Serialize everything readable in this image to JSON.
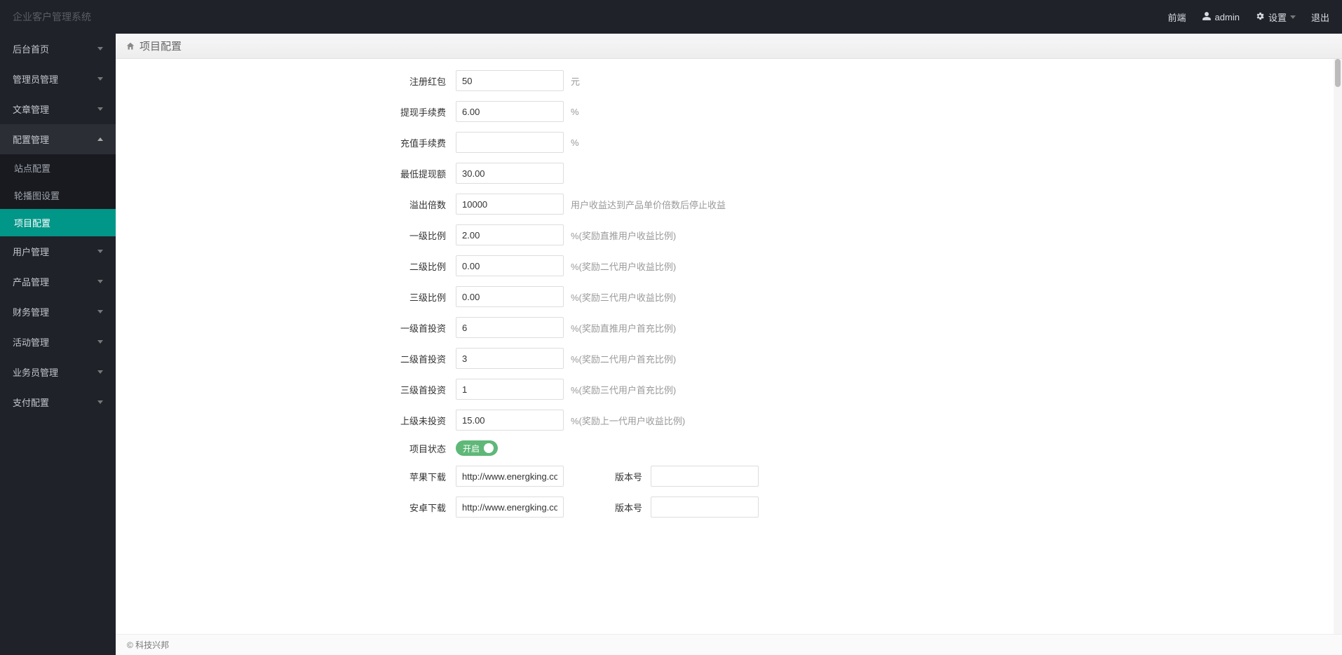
{
  "brand": "企业客户管理系统",
  "header": {
    "frontend": "前端",
    "user": "admin",
    "settings": "设置",
    "logout": "退出"
  },
  "sidebar": {
    "items": [
      {
        "label": "后台首页",
        "expandable": true
      },
      {
        "label": "管理员管理",
        "expandable": true
      },
      {
        "label": "文章管理",
        "expandable": true
      },
      {
        "label": "配置管理",
        "expandable": true,
        "open": true,
        "sub": [
          {
            "label": "站点配置"
          },
          {
            "label": "轮播图设置"
          },
          {
            "label": "项目配置",
            "active": true
          }
        ]
      },
      {
        "label": "用户管理",
        "expandable": true
      },
      {
        "label": "产品管理",
        "expandable": true
      },
      {
        "label": "财务管理",
        "expandable": true
      },
      {
        "label": "活动管理",
        "expandable": true
      },
      {
        "label": "业务员管理",
        "expandable": true
      },
      {
        "label": "支付配置",
        "expandable": true
      }
    ]
  },
  "breadcrumb": {
    "title": "项目配置"
  },
  "form": {
    "register_bonus": {
      "label": "注册红包",
      "value": "50",
      "hint": "元"
    },
    "withdraw_fee": {
      "label": "提现手续费",
      "value": "6.00",
      "hint": "%"
    },
    "recharge_fee": {
      "label": "充值手续费",
      "value": "",
      "hint": "%"
    },
    "min_withdraw": {
      "label": "最低提现额",
      "value": "30.00",
      "hint": ""
    },
    "overflow_multi": {
      "label": "溢出倍数",
      "value": "10000",
      "hint": "用户收益达到产品单价倍数后停止收益"
    },
    "ratio1": {
      "label": "一级比例",
      "value": "2.00",
      "hint": "%(奖励直推用户收益比例)"
    },
    "ratio2": {
      "label": "二级比例",
      "value": "0.00",
      "hint": "%(奖励二代用户收益比例)"
    },
    "ratio3": {
      "label": "三级比例",
      "value": "0.00",
      "hint": "%(奖励三代用户收益比例)"
    },
    "first1": {
      "label": "一级首投资",
      "value": "6",
      "hint": "%(奖励直推用户首充比例)"
    },
    "first2": {
      "label": "二级首投资",
      "value": "3",
      "hint": "%(奖励二代用户首充比例)"
    },
    "first3": {
      "label": "三级首投资",
      "value": "1",
      "hint": "%(奖励三代用户首充比例)"
    },
    "up_noinvest": {
      "label": "上级未投资",
      "value": "15.00",
      "hint": "%(奖励上一代用户收益比例)"
    },
    "status": {
      "label": "项目状态",
      "switch_text": "开启"
    },
    "apple_dl": {
      "label": "苹果下载",
      "value": "http://www.energking.com/do",
      "ver_label": "版本号",
      "ver_value": ""
    },
    "android_dl": {
      "label": "安卓下载",
      "value": "http://www.energking.com/do",
      "ver_label": "版本号",
      "ver_value": ""
    }
  },
  "footer": {
    "copyright": "© 科技兴邦"
  }
}
